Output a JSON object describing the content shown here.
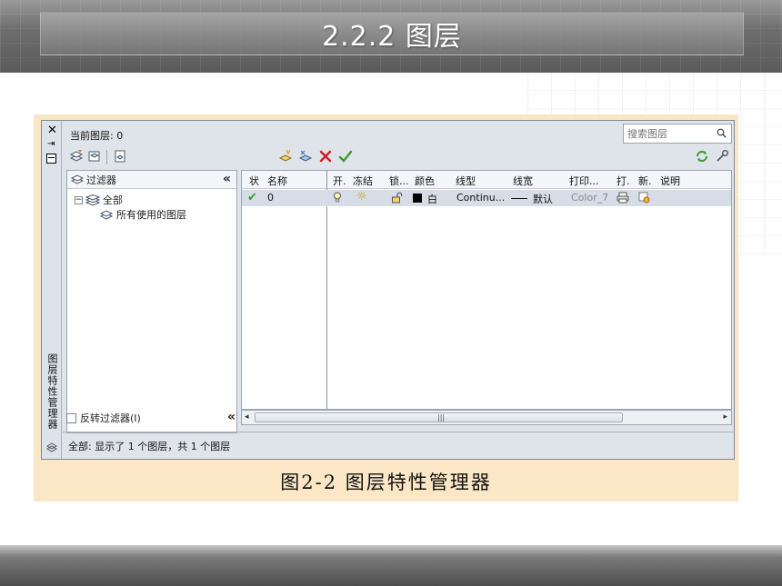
{
  "slide": {
    "title": "2.2.2  图层",
    "caption": "图2-2  图层特性管理器"
  },
  "dialog": {
    "side_title": "图层特性管理器",
    "current_layer": "当前图层: 0",
    "search_placeholder": "搜索图层",
    "tree": {
      "header": "过滤器",
      "items": [
        {
          "label": "全部",
          "level": 0
        },
        {
          "label": "所有使用的图层",
          "level": 1
        }
      ],
      "invert_filter": "反转过滤器(I)"
    },
    "columns": [
      "状",
      "名称",
      "开.",
      "冻结",
      "锁...",
      "颜色",
      "线型",
      "线宽",
      "打印...",
      "打.",
      "新.",
      "说明"
    ],
    "rows": [
      {
        "status": "✔",
        "name": "0",
        "color_name": "白",
        "color_hex": "#000000",
        "linetype": "Continu...",
        "lineweight": "默认",
        "plot_style": "Color_7"
      }
    ],
    "status_text": "全部: 显示了 1 个图层，共 1 个图层"
  },
  "icons": {
    "close": "close-icon",
    "pin": "pin-icon",
    "properties": "properties-icon",
    "new_filter": "new-property-filter-icon",
    "new_group_filter": "new-group-filter-icon",
    "layer_states": "layer-states-manager-icon",
    "new_layer": "new-layer-icon",
    "new_layer_frozen": "new-layer-vp-frozen-icon",
    "delete_layer": "delete-layer-icon",
    "set_current": "set-current-icon",
    "refresh": "refresh-icon",
    "settings": "settings-icon"
  },
  "colors": {
    "accent_green": "#3a9a2a",
    "delete_red": "#d02020",
    "figure_bg": "#fbe7c6",
    "dialog_bg": "#dfe4ea"
  }
}
